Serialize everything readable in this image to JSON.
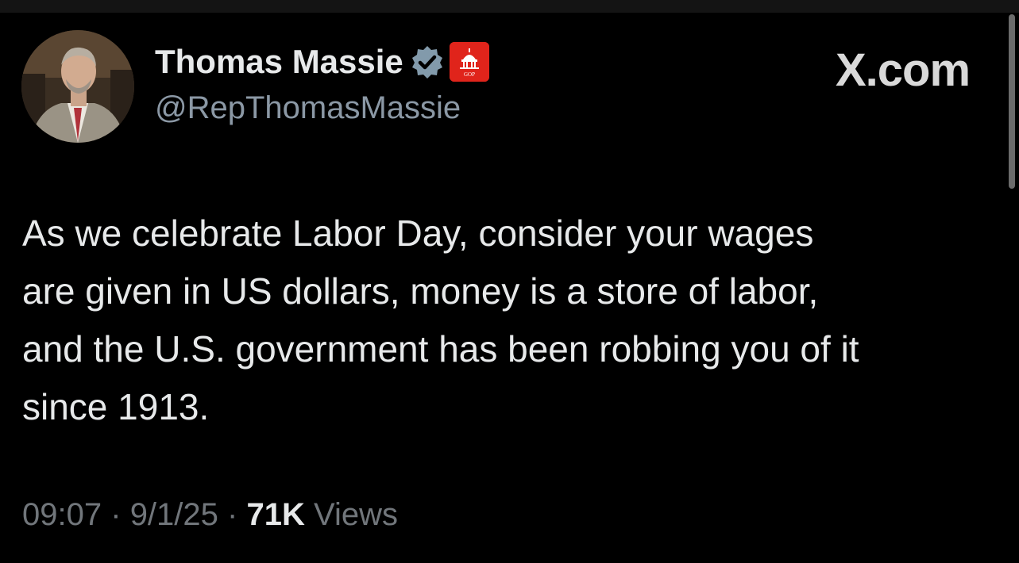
{
  "author": {
    "display_name": "Thomas Massie",
    "handle": "@RepThomasMassie",
    "verified_badge_icon": "verified-check-icon",
    "affiliate_badge_icon": "house-gop-capitol-icon",
    "affiliate_badge_text": "GOP",
    "affiliate_badge_color": "#e0241b",
    "verified_badge_color": "#829aab"
  },
  "site_logo": "X.com",
  "tweet": {
    "text": "As we celebrate Labor Day, consider your wages\nare given in US dollars, money is a store of labor,\nand the U.S. government has been robbing you of it\nsince 1913."
  },
  "meta": {
    "time": "09:07",
    "separator": "·",
    "date": "9/1/25",
    "views_count": "71K",
    "views_label": "Views"
  },
  "colors": {
    "background": "#000000",
    "primary_text": "#e7e9ea",
    "secondary_text": "#71767b",
    "handle_text": "#8b98a5"
  }
}
